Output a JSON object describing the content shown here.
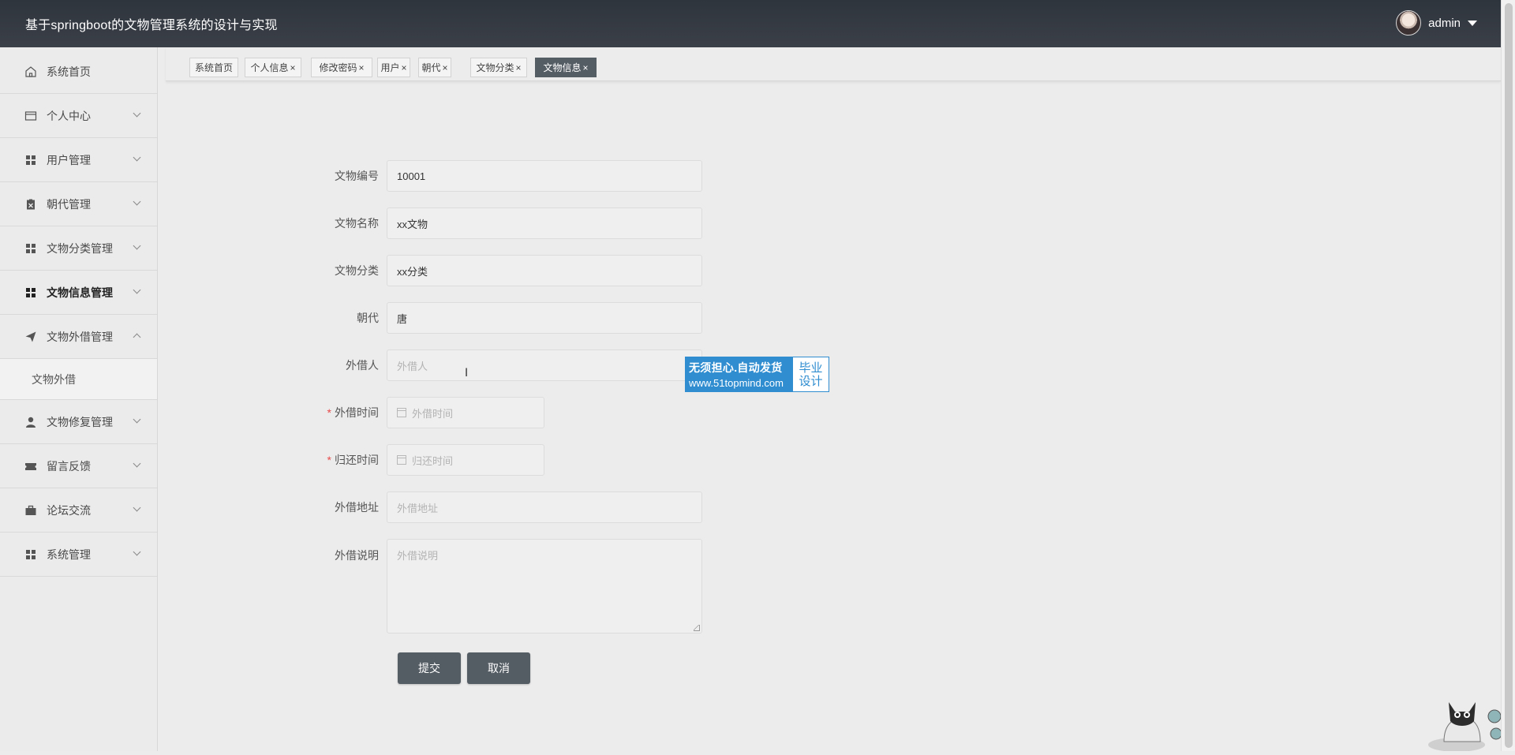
{
  "header": {
    "title": "基于springboot的文物管理系统的设计与实现",
    "username": "admin"
  },
  "sidebar": {
    "items": [
      {
        "label": "系统首页",
        "icon": "home-icon"
      },
      {
        "label": "个人中心",
        "icon": "card-icon"
      },
      {
        "label": "用户管理",
        "icon": "grid-icon"
      },
      {
        "label": "朝代管理",
        "icon": "clipboard-icon"
      },
      {
        "label": "文物分类管理",
        "icon": "grid-icon"
      },
      {
        "label": "文物信息管理",
        "icon": "grid-icon"
      },
      {
        "label": "文物外借管理",
        "icon": "send-icon"
      },
      {
        "label": "文物修复管理",
        "icon": "user-icon"
      },
      {
        "label": "留言反馈",
        "icon": "ticket-icon"
      },
      {
        "label": "论坛交流",
        "icon": "briefcase-icon"
      },
      {
        "label": "系统管理",
        "icon": "grid-icon"
      }
    ],
    "submenu": {
      "label": "文物外借"
    }
  },
  "tabs": [
    {
      "label": "系统首页"
    },
    {
      "label": "个人信息",
      "close": "×"
    },
    {
      "label": "修改密码",
      "close": "×"
    },
    {
      "label": "用户",
      "close": "×"
    },
    {
      "label": "朝代",
      "close": "×"
    },
    {
      "label": "文物分类",
      "close": "×"
    },
    {
      "label": "文物信息",
      "close": "×"
    }
  ],
  "form": {
    "fields": [
      {
        "label": "文物编号",
        "value": "10001"
      },
      {
        "label": "文物名称",
        "value": "xx文物"
      },
      {
        "label": "文物分类",
        "value": "xx分类"
      },
      {
        "label": "朝代",
        "value": "唐"
      },
      {
        "label": "外借人",
        "placeholder": "外借人"
      },
      {
        "label": "外借时间",
        "placeholder": "外借时间",
        "required": "*"
      },
      {
        "label": "归还时间",
        "placeholder": "归还时间",
        "required": "*"
      },
      {
        "label": "外借地址",
        "placeholder": "外借地址"
      },
      {
        "label": "外借说明",
        "placeholder": "外借说明"
      }
    ],
    "submit": "提交",
    "cancel": "取消"
  },
  "watermark": {
    "line1": "无须担心.自动发货",
    "line2": "www.51topmind.com",
    "right1": "毕业",
    "right2": "设计"
  },
  "colors": {
    "header_bg": "#343a42",
    "active_tab": "#545c64",
    "button_bg": "#545c64",
    "required": "#e84a4a",
    "watermark_blue": "#2f8dd0"
  }
}
